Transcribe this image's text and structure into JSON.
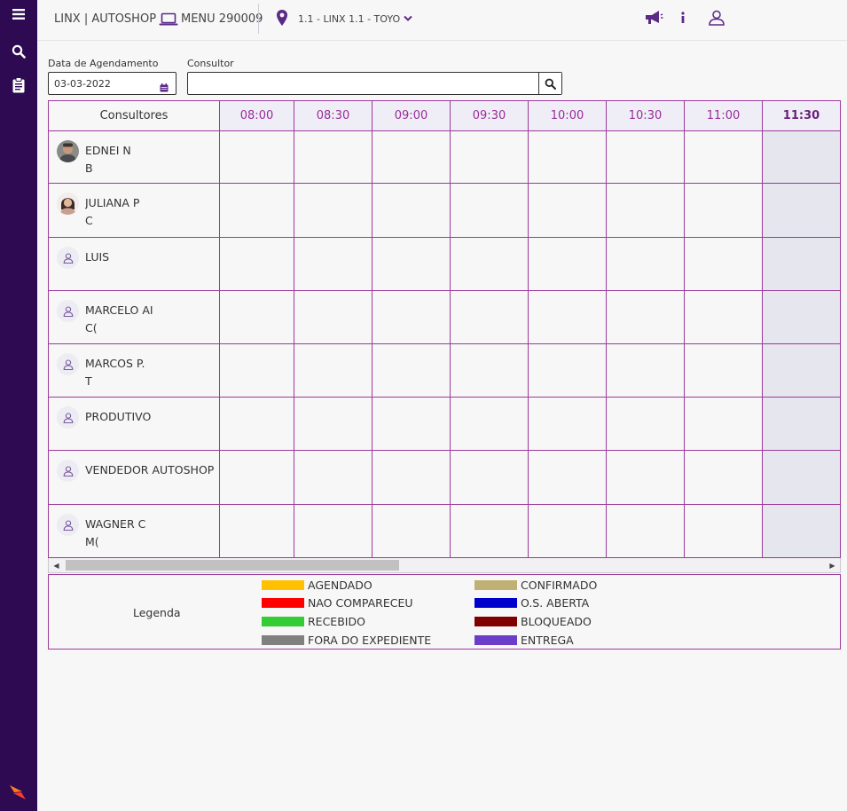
{
  "topbar": {
    "brand": "LINX | AUTOSHOP",
    "menu_label": "MENU 290009",
    "location": "1.1 - LINX 1.1 - TOYO"
  },
  "filters": {
    "date_label": "Data de Agendamento",
    "date_value": "03-03-2022",
    "consultor_label": "Consultor",
    "consultor_value": ""
  },
  "grid": {
    "header_first": "Consultores",
    "time_slots": [
      "08:00",
      "08:30",
      "09:00",
      "09:30",
      "10:00",
      "10:30",
      "11:00",
      "11:30"
    ],
    "current_slot": "11:30",
    "consultants": [
      {
        "line1": "EDNEI N",
        "line2": "B",
        "avatar": "photo-male"
      },
      {
        "line1": "JULIANA P",
        "line2": "C",
        "avatar": "photo-female"
      },
      {
        "line1": "LUIS",
        "line2": "",
        "avatar": "user-icon"
      },
      {
        "line1": "MARCELO AI",
        "line2": "C(",
        "avatar": "user-icon"
      },
      {
        "line1": "MARCOS P.",
        "line2": "T",
        "avatar": "user-icon"
      },
      {
        "line1": "PRODUTIVO",
        "line2": "",
        "avatar": "user-icon"
      },
      {
        "line1": "VENDEDOR AUTOSHOP",
        "line2": "",
        "avatar": "user-icon"
      },
      {
        "line1": "WAGNER C",
        "line2": "M(",
        "avatar": "user-icon"
      }
    ]
  },
  "legend": {
    "title": "Legenda",
    "items": [
      {
        "label": "AGENDADO",
        "color": "#ffc000"
      },
      {
        "label": "NAO COMPARECEU",
        "color": "#ff0000"
      },
      {
        "label": "RECEBIDO",
        "color": "#33cc33"
      },
      {
        "label": "FORA DO EXPEDIENTE",
        "color": "#808080"
      },
      {
        "label": "CONFIRMADO",
        "color": "#bfb073"
      },
      {
        "label": "O.S. ABERTA",
        "color": "#0000cc"
      },
      {
        "label": "BLOQUEADO",
        "color": "#800000"
      },
      {
        "label": "ENTREGA",
        "color": "#6a3ec9"
      }
    ]
  },
  "colors": {
    "sidebar": "#2d0a52",
    "accent": "#9b2c9b",
    "icon": "#5b2a86"
  }
}
